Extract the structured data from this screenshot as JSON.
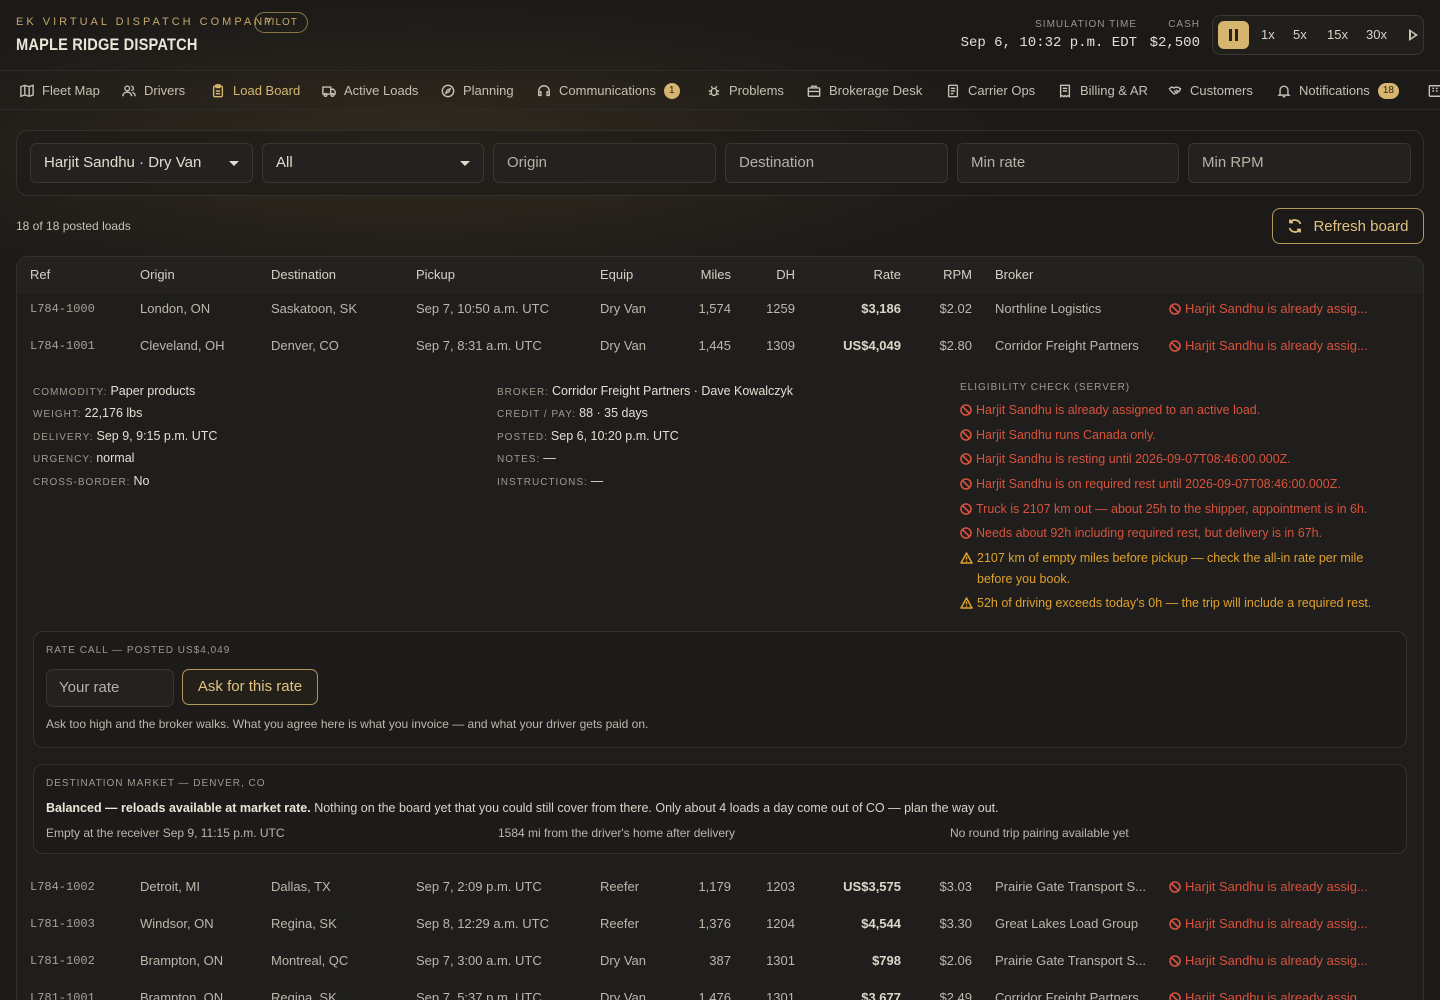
{
  "header": {
    "company": "EK VIRTUAL DISPATCH COMPANY",
    "pilot_badge": "PILOT",
    "brand": "MAPLE RIDGE DISPATCH",
    "sim_label": "SIMULATION TIME",
    "sim_value": "Sep 6, 10:32 p.m. EDT",
    "cash_label": "CASH",
    "cash_value": "$2,500",
    "speeds": [
      "1x",
      "5x",
      "15x",
      "30x"
    ]
  },
  "nav": {
    "tabs": [
      {
        "label": "Fleet Map",
        "icon": "map-icon"
      },
      {
        "label": "Drivers",
        "icon": "users-icon"
      },
      {
        "label": "Load Board",
        "icon": "clipboard-icon",
        "active": true
      },
      {
        "label": "Active Loads",
        "icon": "truck-icon"
      },
      {
        "label": "Planning",
        "icon": "compass-icon"
      },
      {
        "label": "Communications",
        "icon": "headset-icon",
        "badge": "1"
      },
      {
        "label": "Problems",
        "icon": "bug-icon"
      },
      {
        "label": "Brokerage Desk",
        "icon": "building-icon"
      },
      {
        "label": "Carrier Ops",
        "icon": "document-icon"
      },
      {
        "label": "Billing & AR",
        "icon": "receipt-icon"
      },
      {
        "label": "Customers",
        "icon": "handshake-icon"
      },
      {
        "label": "Notifications",
        "icon": "bell-icon",
        "badge": "18"
      }
    ]
  },
  "filters": {
    "driver_select": "Harjit Sandhu · Dry Van",
    "type_select": "All",
    "origin_placeholder": "Origin",
    "destination_placeholder": "Destination",
    "min_rate_placeholder": "Min rate",
    "min_rpm_placeholder": "Min RPM"
  },
  "board": {
    "count": "18 of 18 posted loads",
    "refresh_label": "Refresh board",
    "columns": [
      "Ref",
      "Origin",
      "Destination",
      "Pickup",
      "Equip",
      "Miles",
      "DH",
      "Rate",
      "RPM",
      "Broker"
    ],
    "rows_top": [
      {
        "ref": "L784-1000",
        "origin": "London, ON",
        "destination": "Saskatoon, SK",
        "pickup": "Sep 7, 10:50 a.m. UTC",
        "equip": "Dry Van",
        "miles": "1,574",
        "dh": "1259",
        "rate": "$3,186",
        "rpm": "$2.02",
        "broker": "Northline Logistics",
        "status": "Harjit Sandhu is already assig..."
      },
      {
        "ref": "L784-1001",
        "origin": "Cleveland, OH",
        "destination": "Denver, CO",
        "pickup": "Sep 7, 8:31 a.m. UTC",
        "equip": "Dry Van",
        "miles": "1,445",
        "dh": "1309",
        "rate": "US$4,049",
        "rpm": "$2.80",
        "broker": "Corridor Freight Partners",
        "status": "Harjit Sandhu is already assig..."
      }
    ],
    "rows_bottom": [
      {
        "ref": "L784-1002",
        "origin": "Detroit, MI",
        "destination": "Dallas, TX",
        "pickup": "Sep 7, 2:09 p.m. UTC",
        "equip": "Reefer",
        "miles": "1,179",
        "dh": "1203",
        "rate": "US$3,575",
        "rpm": "$3.03",
        "broker": "Prairie Gate Transport S...",
        "status": "Harjit Sandhu is already assig..."
      },
      {
        "ref": "L781-1003",
        "origin": "Windsor, ON",
        "destination": "Regina, SK",
        "pickup": "Sep 8, 12:29 a.m. UTC",
        "equip": "Reefer",
        "miles": "1,376",
        "dh": "1204",
        "rate": "$4,544",
        "rpm": "$3.30",
        "broker": "Great Lakes Load Group",
        "status": "Harjit Sandhu is already assig..."
      },
      {
        "ref": "L781-1002",
        "origin": "Brampton, ON",
        "destination": "Montreal, QC",
        "pickup": "Sep 7, 3:00 a.m. UTC",
        "equip": "Dry Van",
        "miles": "387",
        "dh": "1301",
        "rate": "$798",
        "rpm": "$2.06",
        "broker": "Prairie Gate Transport S...",
        "status": "Harjit Sandhu is already assig..."
      },
      {
        "ref": "L781-1001",
        "origin": "Brampton, ON",
        "destination": "Regina, SK",
        "pickup": "Sep 7, 5:37 p.m. UTC",
        "equip": "Dry Van",
        "miles": "1,476",
        "dh": "1301",
        "rate": "$3,677",
        "rpm": "$2.49",
        "broker": "Corridor Freight Partners",
        "status": "Harjit Sandhu is already assig..."
      }
    ]
  },
  "detail": {
    "left": [
      {
        "k": "COMMODITY:",
        "v": "Paper products"
      },
      {
        "k": "WEIGHT:",
        "v": "22,176 lbs"
      },
      {
        "k": "DELIVERY:",
        "v": "Sep 9, 9:15 p.m. UTC"
      },
      {
        "k": "URGENCY:",
        "v": "normal"
      },
      {
        "k": "CROSS-BORDER:",
        "v": "No"
      }
    ],
    "mid": [
      {
        "k": "BROKER:",
        "v": "Corridor Freight Partners · Dave Kowalczyk"
      },
      {
        "k": "CREDIT / PAY:",
        "v": "88 · 35 days"
      },
      {
        "k": "POSTED:",
        "v": "Sep 6, 10:20 p.m. UTC"
      },
      {
        "k": "NOTES:",
        "v": "—"
      },
      {
        "k": "INSTRUCTIONS:",
        "v": "—"
      }
    ],
    "eligibility_title": "ELIGIBILITY CHECK (SERVER)",
    "eligibility": [
      {
        "level": "error",
        "text": "Harjit Sandhu is already assigned to an active load."
      },
      {
        "level": "error",
        "text": "Harjit Sandhu runs Canada only."
      },
      {
        "level": "error",
        "text": "Harjit Sandhu is resting until 2026-09-07T08:46:00.000Z."
      },
      {
        "level": "error",
        "text": "Harjit Sandhu is on required rest until 2026-09-07T08:46:00.000Z."
      },
      {
        "level": "error",
        "text": "Truck is 2107 km out — about 25h to the shipper, appointment is in 6h."
      },
      {
        "level": "error",
        "text": "Needs about 92h including required rest, but delivery is in 67h."
      },
      {
        "level": "warning",
        "text": "2107 km of empty miles before pickup — check the all-in rate per mile before you book."
      },
      {
        "level": "warning",
        "text": "52h of driving exceeds today's 0h — the trip will include a required rest."
      }
    ],
    "rate_call": {
      "title": "RATE CALL — POSTED US$4,049",
      "input_placeholder": "Your rate",
      "ask_label": "Ask for this rate",
      "note": "Ask too high and the broker walks. What you agree here is what you invoice — and what your driver gets paid on."
    },
    "market": {
      "title": "DESTINATION MARKET — DENVER, CO",
      "headline": "Balanced — reloads available at market rate.",
      "text": "Nothing on the board yet that you could still cover from there. Only about 4 loads a day come out of CO — plan the way out.",
      "empty_at": "Empty at the receiver Sep 9, 11:15 p.m. UTC",
      "home": "1584 mi from the driver's home after delivery",
      "round_trip": "No round trip pairing available yet"
    }
  },
  "colors": {
    "accent": "#d6b66e",
    "error": "#d8523c",
    "warning": "#e0a12e",
    "background": "#1b1a18"
  }
}
